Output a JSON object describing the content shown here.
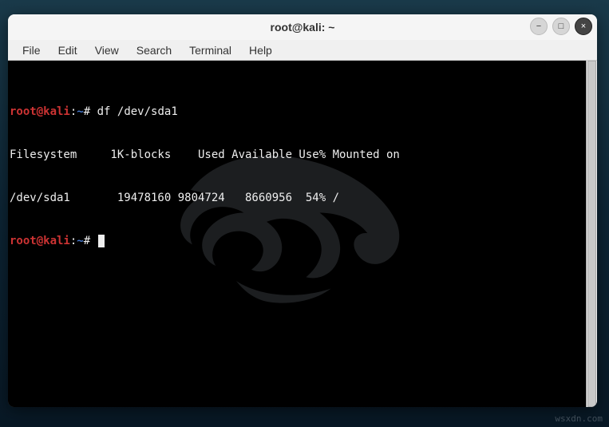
{
  "window": {
    "title": "root@kali: ~"
  },
  "menubar": {
    "items": [
      "File",
      "Edit",
      "View",
      "Search",
      "Terminal",
      "Help"
    ]
  },
  "window_controls": {
    "minimize": "−",
    "maximize": "□",
    "close": "×"
  },
  "prompt": {
    "user_host": "root@kali",
    "sep": ":",
    "path": "~",
    "mark": "#"
  },
  "terminal": {
    "command1": " df /dev/sda1",
    "output_header": "Filesystem     1K-blocks    Used Available Use% Mounted on",
    "output_row": "/dev/sda1       19478160 9804724   8660956  54% /"
  },
  "watermark": "wsxdn.com"
}
